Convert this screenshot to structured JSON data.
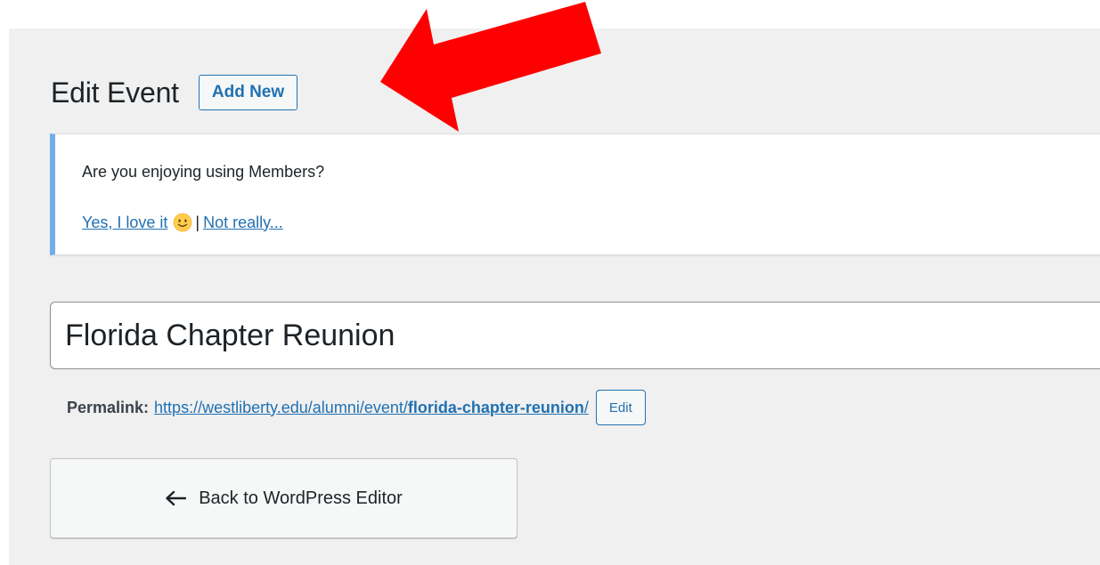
{
  "header": {
    "title": "Edit Event",
    "add_new_label": "Add New"
  },
  "notice": {
    "question": "Are you enjoying using Members?",
    "yes_link": "Yes, I love it",
    "emoji_icon": "slightly-smiling-face-icon",
    "separator": "|",
    "no_link": "Not really...",
    "accent_color": "#72aee6"
  },
  "post": {
    "title_value": "Florida Chapter Reunion"
  },
  "permalink": {
    "label": "Permalink:",
    "base_url": "https://westliberty.edu/alumni/event/",
    "slug": "florida-chapter-reunion",
    "trailing": "/",
    "edit_label": "Edit"
  },
  "back_button": {
    "icon": "arrow-left-icon",
    "label": "Back to WordPress Editor"
  },
  "annotation": {
    "icon": "red-arrow-annotation",
    "color": "#ff0000"
  },
  "colors": {
    "link": "#2271b1",
    "background": "#f0f0f1",
    "text": "#1d2327"
  }
}
